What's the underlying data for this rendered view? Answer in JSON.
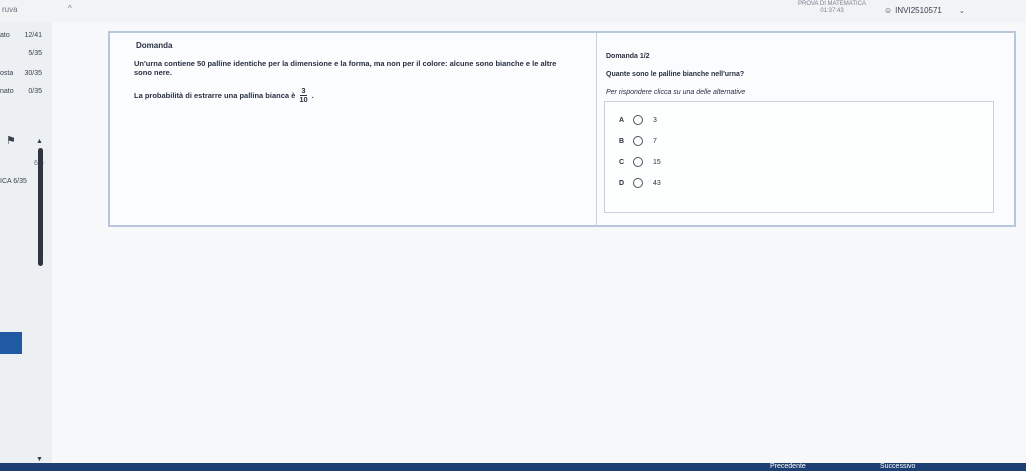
{
  "topbar": {
    "left_title": "ruva",
    "center_title": "PROVA DI MATEMATICA",
    "timer": "01:37:43",
    "user_code": "INVI2510571"
  },
  "sidebar": {
    "rows": [
      {
        "label": "ato",
        "value": "12/41"
      },
      {
        "label": "",
        "value": "5/35"
      },
      {
        "label": "osta",
        "value": "30/35"
      },
      {
        "label": "nato",
        "value": "0/35"
      }
    ],
    "section_value": "6/6",
    "section_label": "ICA 6/35"
  },
  "question": {
    "header": "Domanda",
    "text": "Un'urna contiene 50 palline identiche per la dimensione e la forma, ma non per il colore: alcune sono bianche e le altre sono nere.",
    "prob_text": "La probabilità di estrarre una pallina bianca è",
    "frac_num": "3",
    "frac_den": "10"
  },
  "answer_panel": {
    "counter": "Domanda 1/2",
    "prompt": "Quante sono le palline bianche nell'urna?",
    "hint": "Per rispondere clicca su una delle alternative",
    "options": [
      {
        "letter": "A",
        "value": "3"
      },
      {
        "letter": "B",
        "value": "7"
      },
      {
        "letter": "C",
        "value": "15"
      },
      {
        "letter": "D",
        "value": "43"
      }
    ]
  },
  "bottombar": {
    "prev_label": "Precedente",
    "next_label": "Successivo"
  },
  "colors": {
    "bottom_bar": "#1e3f73",
    "accent": "#1f5aa3"
  }
}
